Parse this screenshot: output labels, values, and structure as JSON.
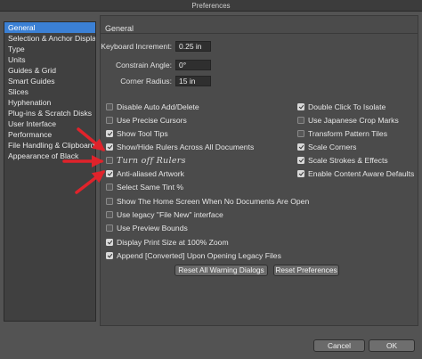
{
  "window": {
    "title": "Preferences"
  },
  "sidebar": {
    "items": [
      {
        "label": "General"
      },
      {
        "label": "Selection & Anchor Display"
      },
      {
        "label": "Type"
      },
      {
        "label": "Units"
      },
      {
        "label": "Guides & Grid"
      },
      {
        "label": "Smart Guides"
      },
      {
        "label": "Slices"
      },
      {
        "label": "Hyphenation"
      },
      {
        "label": "Plug-ins & Scratch Disks"
      },
      {
        "label": "User Interface"
      },
      {
        "label": "Performance"
      },
      {
        "label": "File Handling & Clipboard"
      },
      {
        "label": "Appearance of Black"
      }
    ],
    "selected": "General"
  },
  "general": {
    "title": "General",
    "keyboard_increment": {
      "label": "Keyboard Increment:",
      "value": "0.25 in"
    },
    "constrain_angle": {
      "label": "Constrain Angle:",
      "value": "0°"
    },
    "corner_radius": {
      "label": "Corner Radius:",
      "value": "15 in"
    }
  },
  "options_left": [
    {
      "label": "Disable Auto Add/Delete",
      "checked": false
    },
    {
      "label": "Use Precise Cursors",
      "checked": false
    },
    {
      "label": "Show Tool Tips",
      "checked": true
    },
    {
      "label": "Show/Hide Rulers Across All Documents",
      "checked": true
    },
    {
      "label": "Turn off Rulers",
      "checked": false
    },
    {
      "label": "Anti-aliased Artwork",
      "checked": true
    },
    {
      "label": "Select Same Tint %",
      "checked": false
    },
    {
      "label": "Show The Home Screen When No Documents Are Open",
      "checked": false
    },
    {
      "label": "Use legacy \"File New\" interface",
      "checked": false
    },
    {
      "label": "Use Preview Bounds",
      "checked": false
    },
    {
      "label": "Display Print Size at 100% Zoom",
      "checked": true
    },
    {
      "label": "Append [Converted] Upon Opening Legacy Files",
      "checked": true
    }
  ],
  "options_right": [
    {
      "label": "Double Click To Isolate",
      "checked": true
    },
    {
      "label": "Use Japanese Crop Marks",
      "checked": false
    },
    {
      "label": "Transform Pattern Tiles",
      "checked": false
    },
    {
      "label": "Scale Corners",
      "checked": true
    },
    {
      "label": "Scale Strokes & Effects",
      "checked": true
    },
    {
      "label": "Enable Content Aware Defaults",
      "checked": true
    }
  ],
  "buttons": {
    "reset_warnings": "Reset All Warning Dialogs",
    "reset_prefs": "Reset Preferences",
    "cancel": "Cancel",
    "ok": "OK"
  },
  "colors": {
    "annotation_arrow": "#e0232b",
    "selection": "#3b80d5"
  }
}
